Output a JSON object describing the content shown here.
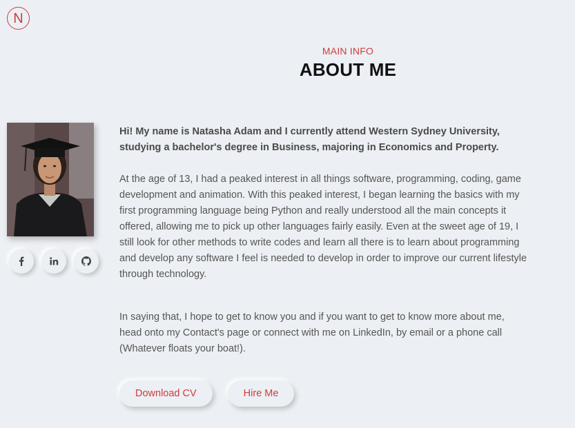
{
  "logo": {
    "letter": "N"
  },
  "header": {
    "subtitle": "MAIN INFO",
    "title": "ABOUT ME"
  },
  "profile": {
    "photo_alt": "Profile photo"
  },
  "socials": [
    {
      "name": "facebook",
      "glyph": "f"
    },
    {
      "name": "linkedin",
      "glyph": "in"
    },
    {
      "name": "github",
      "glyph": "github"
    }
  ],
  "content": {
    "intro": "Hi! My name is Natasha Adam and I currently attend Western Sydney University, studying a bachelor's degree in Business, majoring in Economics and Property.",
    "para1": "At the age of 13, I had a peaked interest in all things software, programming, coding, game development and animation. With this peaked interest, I began learning the basics with my first programming language being Python and really understood all the main concepts it offered, allowing me to pick up other languages fairly easily. Even at the sweet age of 19, I still look for other methods to write codes and learn all there is to learn about programming and develop any software I feel is needed to develop in order to improve our current lifestyle through technology.",
    "para2": "In saying that, I hope to get to know you and if you want to get to know more about me, head onto my Contact's page or connect with me on LinkedIn, by email or a phone call (Whatever floats your boat!)."
  },
  "buttons": {
    "download_cv": "Download CV",
    "hire_me": "Hire Me"
  },
  "colors": {
    "accent": "#d13b3b",
    "background": "#eceff3",
    "heading": "#111111",
    "text": "#555555"
  }
}
